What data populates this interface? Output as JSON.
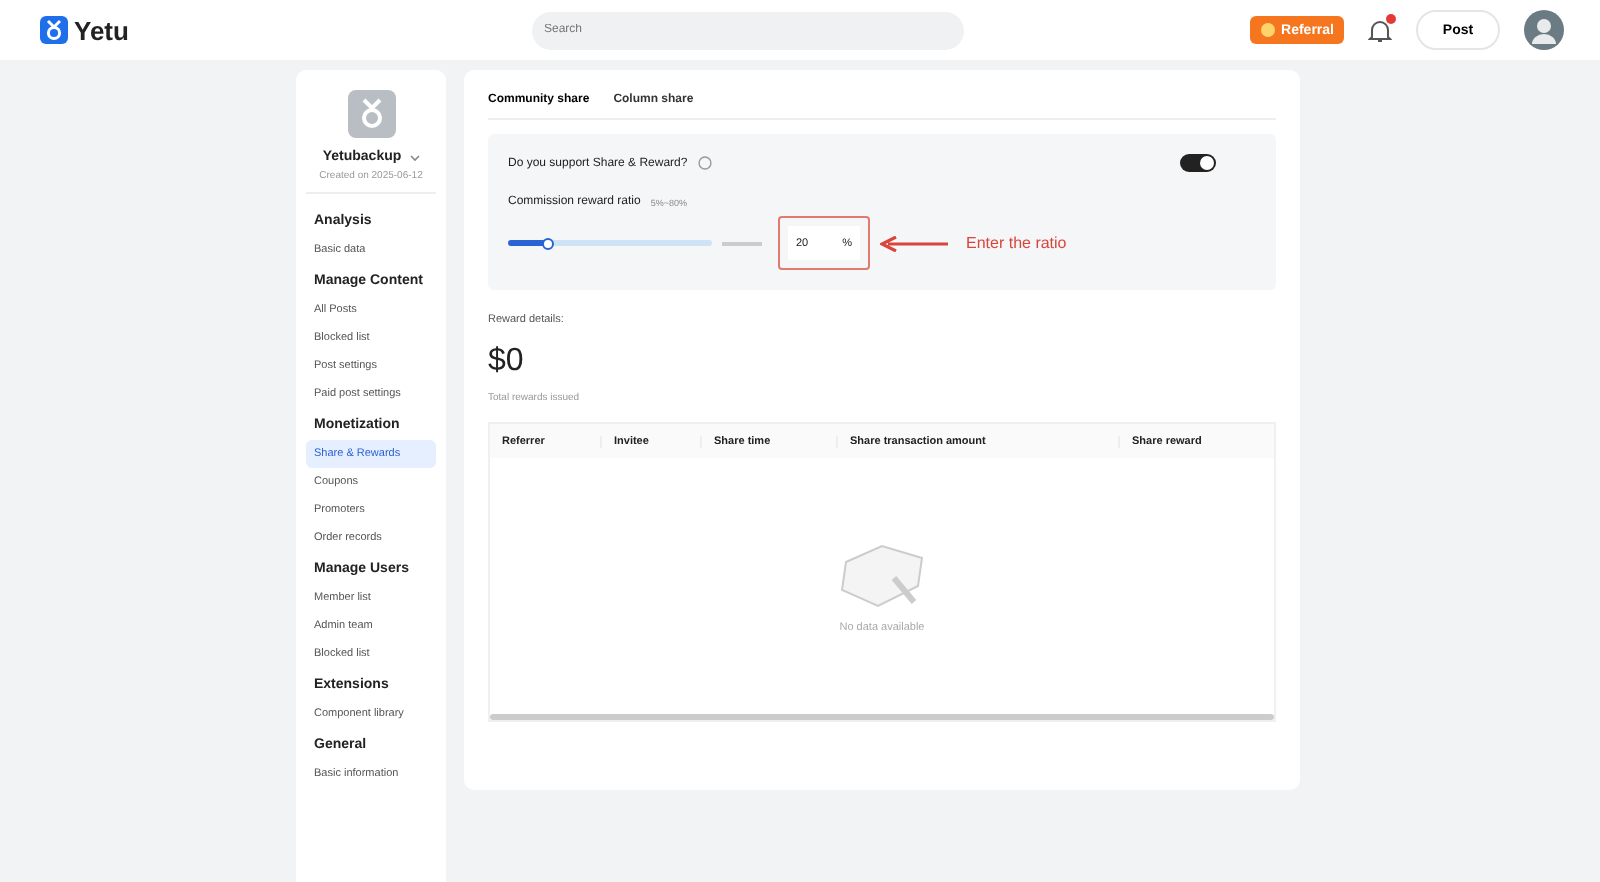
{
  "header": {
    "logo": "Yetu",
    "search": {
      "placeholder": "Search"
    },
    "referral": "Referral",
    "notifications": {
      "badge": true
    },
    "post": "Post"
  },
  "sidebar": {
    "account": {
      "name": "Yetubackup",
      "created": "Created on 2025-06-12"
    },
    "groups": [
      {
        "title": "Analysis",
        "items": [
          {
            "label": "Basic data",
            "selected": false
          }
        ]
      },
      {
        "title": "Manage Content",
        "items": [
          {
            "label": "All Posts",
            "selected": false
          },
          {
            "label": "Blocked list",
            "selected": false
          },
          {
            "label": "Post settings",
            "selected": false
          },
          {
            "label": "Paid post settings",
            "selected": false
          }
        ]
      },
      {
        "title": "Monetization",
        "items": [
          {
            "label": "Share & Rewards",
            "selected": true
          },
          {
            "label": "Coupons",
            "selected": false
          },
          {
            "label": "Promoters",
            "selected": false
          },
          {
            "label": "Order records",
            "selected": false
          }
        ]
      },
      {
        "title": "Manage Users",
        "items": [
          {
            "label": "Member list",
            "selected": false
          },
          {
            "label": "Admin team",
            "selected": false
          },
          {
            "label": "Blocked list",
            "selected": false
          }
        ]
      },
      {
        "title": "Extensions",
        "items": [
          {
            "label": "Component library",
            "selected": false
          }
        ]
      },
      {
        "title": "General",
        "items": [
          {
            "label": "Basic information",
            "selected": false
          }
        ]
      }
    ]
  },
  "tabs": [
    {
      "label": "Community share",
      "selected": true
    },
    {
      "label": "Column share",
      "selected": false
    }
  ],
  "settings": {
    "support_label": "Do you support Share & Reward?",
    "support_on": true,
    "ratio_label": "Commission reward ratio",
    "ratio_range": "5%~80%",
    "level": 0.2,
    "ratio_value": "20",
    "unit": "%",
    "annotation": "Enter the ratio"
  },
  "rewards": {
    "label": "Reward details:",
    "amount": "$0",
    "caption": "Total rewards issued"
  },
  "table": {
    "columns": [
      "Referrer",
      "Invitee",
      "Share time",
      "Share transaction amount",
      "Share reward"
    ],
    "empty": "No data available"
  }
}
